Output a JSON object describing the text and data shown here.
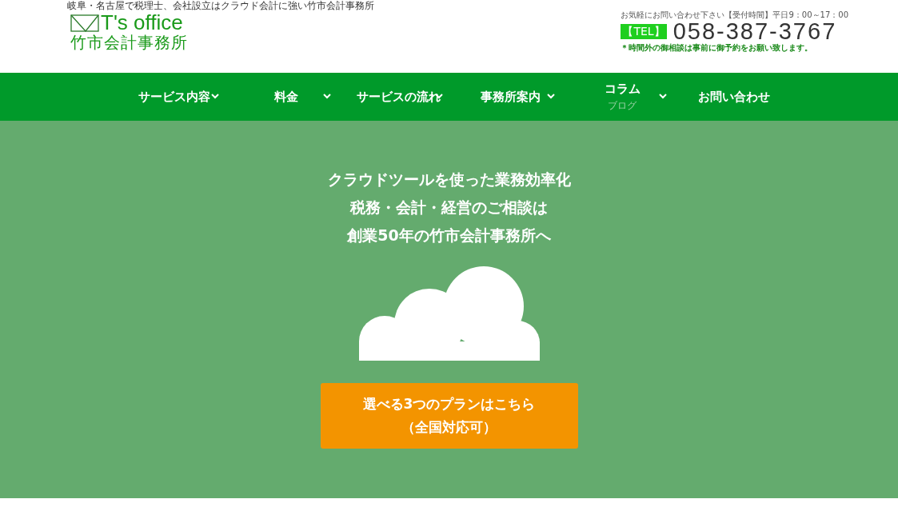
{
  "header": {
    "tagline": "岐阜・名古屋で税理士、会社設立はクラウド会計に強い竹市会計事務所",
    "logo": {
      "brand": "T's office",
      "name": "竹市会計事務所"
    },
    "contact": {
      "hours": "お気軽にお問い合わせ下さい【受付時間】平日9：00～17：00",
      "tel_label": "【TEL】",
      "phone": "058-387-3767",
      "note": "＊時間外の御相談は事前に御予約をお願い致します。"
    }
  },
  "nav": [
    {
      "label": "サービス内容",
      "dropdown": true
    },
    {
      "label": "料金",
      "dropdown": true
    },
    {
      "label": "サービスの流れ",
      "dropdown": true
    },
    {
      "label": "事務所案内",
      "dropdown": true
    },
    {
      "label": "コラム",
      "sub": "ブログ",
      "dropdown": true
    },
    {
      "label": "お問い合わせ",
      "dropdown": false
    }
  ],
  "hero": {
    "headline": [
      "クラウドツールを使った業務効率化",
      "税務・会計・経営のご相談は",
      "創業50年の竹市会計事務所へ"
    ],
    "button": [
      "選べる3つのプランはこちら",
      "（全国対応可）"
    ]
  }
}
